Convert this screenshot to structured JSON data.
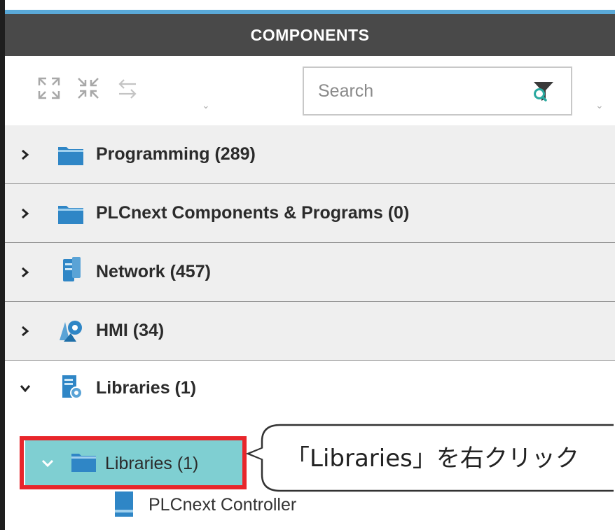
{
  "panel": {
    "title": "COMPONENTS"
  },
  "toolbar": {
    "expand_all_icon": "expand-all-icon",
    "collapse_all_icon": "collapse-all-icon",
    "sync_icon": "sync-icon",
    "search_placeholder": "Search",
    "filter_icon": "filter-search-icon"
  },
  "categories": [
    {
      "label": "Programming (289)",
      "icon": "folder-icon",
      "expanded": false
    },
    {
      "label": "PLCnext Components & Programs (0)",
      "icon": "folder-icon",
      "expanded": false
    },
    {
      "label": "Network (457)",
      "icon": "network-device-icon",
      "expanded": false
    },
    {
      "label": "HMI (34)",
      "icon": "hmi-icon",
      "expanded": false
    },
    {
      "label": "Libraries (1)",
      "icon": "library-icon",
      "expanded": true
    }
  ],
  "libraries_tree": {
    "folder_label": "Libraries (1)",
    "item_label": "PLCnext Controller"
  },
  "callout": {
    "text": "「Libraries」を右クリック"
  },
  "colors": {
    "title_bg": "#494949",
    "accent": "#5aa9d8",
    "selected_row": "#7fcfd2",
    "highlight_border": "#e8262b",
    "folder_blue": "#2f86c6"
  }
}
